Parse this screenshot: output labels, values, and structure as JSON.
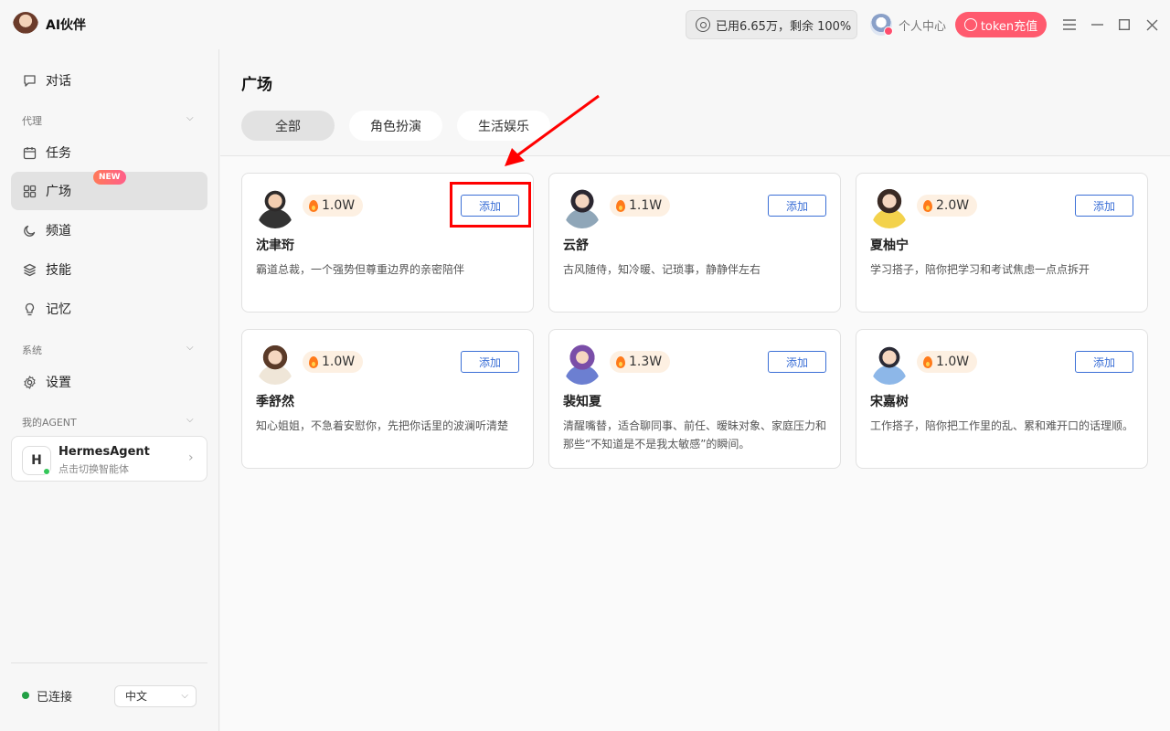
{
  "app": {
    "title": "AI伙伴"
  },
  "header": {
    "usage_text": "已用6.65万，剩余 100%",
    "user_center": "个人中心",
    "token_button": "token充值"
  },
  "sidebar": {
    "chat": "对话",
    "section_agent": "代理",
    "tasks": "任务",
    "plaza": "广场",
    "new_badge": "NEW",
    "channels": "频道",
    "skills": "技能",
    "memory": "记忆",
    "section_system": "系统",
    "settings": "设置",
    "section_my_agent": "我的AGENT",
    "agent": {
      "initial": "H",
      "name": "HermesAgent",
      "subtitle": "点击切换智能体"
    },
    "status": "已连接",
    "language": "中文"
  },
  "main": {
    "title": "广场",
    "tabs": [
      {
        "label": "全部",
        "active": true
      },
      {
        "label": "角色扮演",
        "active": false
      },
      {
        "label": "生活娱乐",
        "active": false
      }
    ],
    "add_label": "添加",
    "cards": [
      {
        "name": "沈聿珩",
        "hot": "1.0W",
        "desc": "霸道总裁，一个强势但尊重边界的亲密陪伴"
      },
      {
        "name": "云舒",
        "hot": "1.1W",
        "desc": "古风随侍，知冷暖、记琐事，静静伴左右"
      },
      {
        "name": "夏柚宁",
        "hot": "2.0W",
        "desc": "学习搭子，陪你把学习和考试焦虑一点点拆开"
      },
      {
        "name": "季舒然",
        "hot": "1.0W",
        "desc": "知心姐姐，不急着安慰你，先把你话里的波澜听清楚"
      },
      {
        "name": "裴知夏",
        "hot": "1.3W",
        "desc": "清醒嘴替，适合聊同事、前任、暧昧对象、家庭压力和那些“不知道是不是我太敏感”的瞬间。"
      },
      {
        "name": "宋嘉树",
        "hot": "1.0W",
        "desc": "工作搭子，陪你把工作里的乱、累和难开口的话理顺。"
      }
    ]
  },
  "colors": {
    "accent_blue": "#3b6fd6",
    "token_pink": "#ff5a6e",
    "annotation_red": "#ff0000"
  },
  "icons": [
    "chat-icon",
    "calendar-icon",
    "grid-icon",
    "moon-icon",
    "layers-icon",
    "bulb-icon",
    "gear-icon",
    "flame-icon"
  ]
}
